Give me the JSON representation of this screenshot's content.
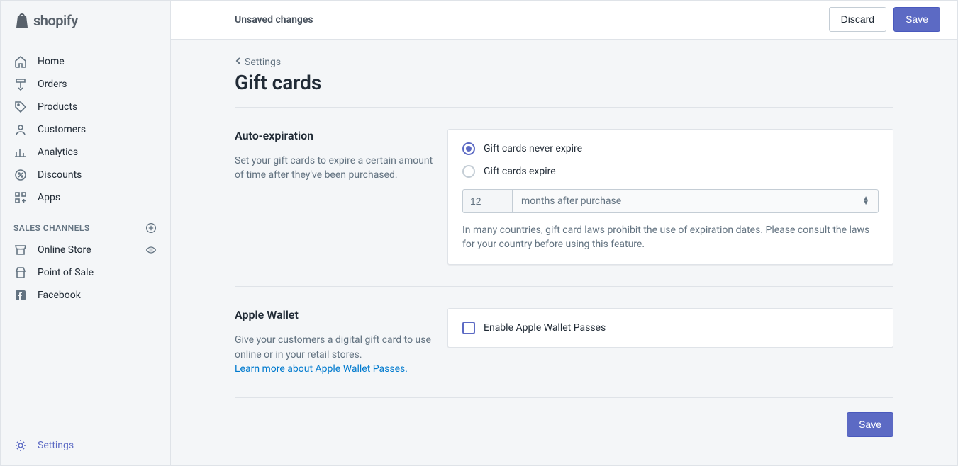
{
  "brand": {
    "name": "shopify"
  },
  "topbar": {
    "unsaved_label": "Unsaved changes",
    "discard_label": "Discard",
    "save_label": "Save"
  },
  "sidebar": {
    "items": [
      {
        "label": "Home",
        "icon": "home-icon"
      },
      {
        "label": "Orders",
        "icon": "orders-icon"
      },
      {
        "label": "Products",
        "icon": "products-icon"
      },
      {
        "label": "Customers",
        "icon": "customers-icon"
      },
      {
        "label": "Analytics",
        "icon": "analytics-icon"
      },
      {
        "label": "Discounts",
        "icon": "discounts-icon"
      },
      {
        "label": "Apps",
        "icon": "apps-icon"
      }
    ],
    "channels_header": "SALES CHANNELS",
    "channels": [
      {
        "label": "Online Store",
        "icon": "online-store-icon",
        "right": "eye-icon"
      },
      {
        "label": "Point of Sale",
        "icon": "point-of-sale-icon"
      },
      {
        "label": "Facebook",
        "icon": "facebook-icon"
      }
    ],
    "settings_label": "Settings"
  },
  "breadcrumb": {
    "label": "Settings"
  },
  "page": {
    "title": "Gift cards"
  },
  "auto_expiration": {
    "heading": "Auto-expiration",
    "description": "Set your gift cards to expire a certain amount of time after they've been purchased.",
    "option_never": "Gift cards never expire",
    "option_expire": "Gift cards expire",
    "selected": "never",
    "duration_value": "12",
    "unit_label": "months after purchase",
    "note": "In many countries, gift card laws prohibit the use of expiration dates. Please consult the laws for your country before using this feature."
  },
  "apple_wallet": {
    "heading": "Apple Wallet",
    "description": "Give your customers a digital gift card to use online or in your retail stores.",
    "link_text": "Learn more about Apple Wallet Passes.",
    "checkbox_label": "Enable Apple Wallet Passes",
    "checked": false
  },
  "footer": {
    "save_label": "Save"
  }
}
